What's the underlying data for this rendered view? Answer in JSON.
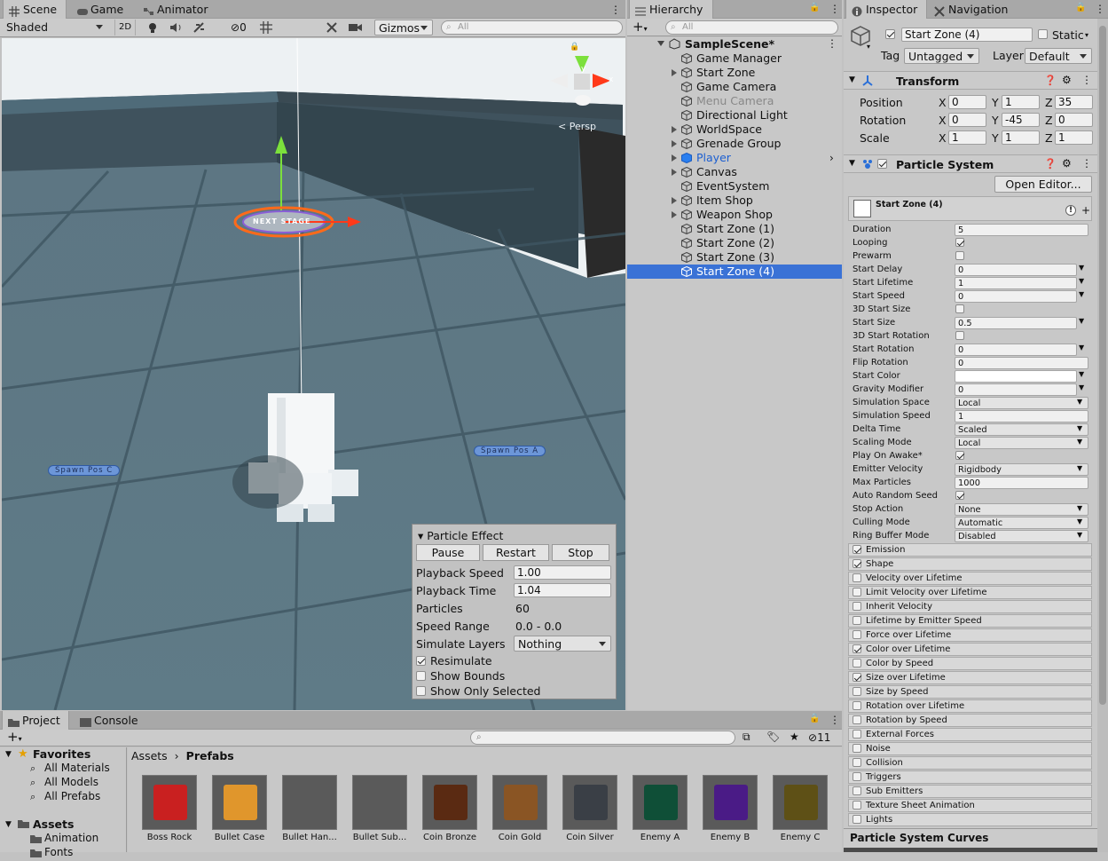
{
  "scene_tabs": [
    "Scene",
    "Game",
    "Animator"
  ],
  "scene_toolbar": {
    "shading": "Shaded",
    "mode_2d": "2D",
    "hidden_count": "0",
    "gizmos": "Gizmos",
    "search_placeholder": "All"
  },
  "scene_view": {
    "persp_label": "< Persp",
    "axis_x": "x",
    "axis_y": "y",
    "marker_a": "Spawn Pos A",
    "marker_c": "Spawn Pos C",
    "stage_text": "NEXT STAGE"
  },
  "particle_effect": {
    "title": "Particle Effect",
    "pause": "Pause",
    "restart": "Restart",
    "stop": "Stop",
    "playback_speed_label": "Playback Speed",
    "playback_speed": "1.00",
    "playback_time_label": "Playback Time",
    "playback_time": "1.04",
    "particles_label": "Particles",
    "particles": "60",
    "speed_range_label": "Speed Range",
    "speed_range": "0.0 - 0.0",
    "simulate_layers_label": "Simulate Layers",
    "simulate_layers": "Nothing",
    "resimulate": "Resimulate",
    "show_bounds": "Show Bounds",
    "show_only_selected": "Show Only Selected"
  },
  "hierarchy": {
    "tab": "Hierarchy",
    "search_placeholder": "All",
    "scene": "SampleScene*",
    "items": [
      {
        "label": "Game Manager",
        "arrow": false
      },
      {
        "label": "Start Zone",
        "arrow": true
      },
      {
        "label": "Game Camera",
        "arrow": false
      },
      {
        "label": "Menu Camera",
        "arrow": false
      },
      {
        "label": "Directional Light",
        "arrow": false
      },
      {
        "label": "WorldSpace",
        "arrow": true
      },
      {
        "label": "Grenade Group",
        "arrow": true
      },
      {
        "label": "Player",
        "arrow": true
      },
      {
        "label": "Canvas",
        "arrow": true
      },
      {
        "label": "EventSystem",
        "arrow": false
      },
      {
        "label": "Item Shop",
        "arrow": true
      },
      {
        "label": "Weapon Shop",
        "arrow": true
      },
      {
        "label": "Start Zone (1)",
        "arrow": false
      },
      {
        "label": "Start Zone (2)",
        "arrow": false
      },
      {
        "label": "Start Zone (3)",
        "arrow": false
      },
      {
        "label": "Start Zone (4)",
        "arrow": false
      }
    ]
  },
  "inspector": {
    "tabs": [
      "Inspector",
      "Navigation"
    ],
    "object_name": "Start Zone (4)",
    "static_label": "Static",
    "tag_label": "Tag",
    "tag": "Untagged",
    "layer_label": "Layer",
    "layer": "Default",
    "transform_title": "Transform",
    "position_label": "Position",
    "position": [
      "0",
      "1",
      "35"
    ],
    "rotation_label": "Rotation",
    "rotation": [
      "0",
      "-45",
      "0"
    ],
    "scale_label": "Scale",
    "scale": [
      "1",
      "1",
      "1"
    ],
    "axes": [
      "X",
      "Y",
      "Z"
    ],
    "ps_title": "Particle System",
    "open_editor": "Open Editor...",
    "ps_name": "Start Zone (4)",
    "props": [
      {
        "label": "Duration",
        "value": "5",
        "kind": "field"
      },
      {
        "label": "Looping",
        "value": "",
        "kind": "check_on"
      },
      {
        "label": "Prewarm",
        "value": "",
        "kind": "check_off"
      },
      {
        "label": "Start Delay",
        "value": "0",
        "kind": "fielddd"
      },
      {
        "label": "Start Lifetime",
        "value": "1",
        "kind": "fielddd"
      },
      {
        "label": "Start Speed",
        "value": "0",
        "kind": "fielddd"
      },
      {
        "label": "3D Start Size",
        "value": "",
        "kind": "check_off"
      },
      {
        "label": "Start Size",
        "value": "0.5",
        "kind": "fielddd"
      },
      {
        "label": "3D Start Rotation",
        "value": "",
        "kind": "check_off"
      },
      {
        "label": "Start Rotation",
        "value": "0",
        "kind": "fielddd"
      },
      {
        "label": "Flip Rotation",
        "value": "0",
        "kind": "field"
      },
      {
        "label": "Start Color",
        "value": "",
        "kind": "color"
      },
      {
        "label": "Gravity Modifier",
        "value": "0",
        "kind": "fielddd"
      },
      {
        "label": "Simulation Space",
        "value": "Local",
        "kind": "select"
      },
      {
        "label": "Simulation Speed",
        "value": "1",
        "kind": "field"
      },
      {
        "label": "Delta Time",
        "value": "Scaled",
        "kind": "select"
      },
      {
        "label": "Scaling Mode",
        "value": "Local",
        "kind": "select"
      },
      {
        "label": "Play On Awake*",
        "value": "",
        "kind": "check_on"
      },
      {
        "label": "Emitter Velocity",
        "value": "Rigidbody",
        "kind": "select"
      },
      {
        "label": "Max Particles",
        "value": "1000",
        "kind": "field"
      },
      {
        "label": "Auto Random Seed",
        "value": "",
        "kind": "check_on"
      },
      {
        "label": "Stop Action",
        "value": "None",
        "kind": "select"
      },
      {
        "label": "Culling Mode",
        "value": "Automatic",
        "kind": "select"
      },
      {
        "label": "Ring Buffer Mode",
        "value": "Disabled",
        "kind": "select"
      }
    ],
    "modules": [
      {
        "label": "Emission",
        "on": true
      },
      {
        "label": "Shape",
        "on": true
      },
      {
        "label": "Velocity over Lifetime",
        "on": false
      },
      {
        "label": "Limit Velocity over Lifetime",
        "on": false
      },
      {
        "label": "Inherit Velocity",
        "on": false
      },
      {
        "label": "Lifetime by Emitter Speed",
        "on": false
      },
      {
        "label": "Force over Lifetime",
        "on": false
      },
      {
        "label": "Color over Lifetime",
        "on": true
      },
      {
        "label": "Color by Speed",
        "on": false
      },
      {
        "label": "Size over Lifetime",
        "on": true
      },
      {
        "label": "Size by Speed",
        "on": false
      },
      {
        "label": "Rotation over Lifetime",
        "on": false
      },
      {
        "label": "Rotation by Speed",
        "on": false
      },
      {
        "label": "External Forces",
        "on": false
      },
      {
        "label": "Noise",
        "on": false
      },
      {
        "label": "Collision",
        "on": false
      },
      {
        "label": "Triggers",
        "on": false
      },
      {
        "label": "Sub Emitters",
        "on": false
      },
      {
        "label": "Texture Sheet Animation",
        "on": false
      },
      {
        "label": "Lights",
        "on": false
      }
    ],
    "curves_title": "Particle System Curves"
  },
  "project": {
    "tabs": [
      "Project",
      "Console"
    ],
    "hidden_count": "11",
    "favorites_label": "Favorites",
    "favorites": [
      "All Materials",
      "All Models",
      "All Prefabs"
    ],
    "assets_label": "Assets",
    "asset_folders": [
      "Animation",
      "Fonts"
    ],
    "breadcrumb": [
      "Assets",
      "Prefabs"
    ],
    "assets": [
      {
        "label": "Boss Rock",
        "color": "#c92020"
      },
      {
        "label": "Bullet Case",
        "color": "#e0962c"
      },
      {
        "label": "Bullet Han...",
        "color": ""
      },
      {
        "label": "Bullet Sub...",
        "color": ""
      },
      {
        "label": "Coin Bronze",
        "color": "#5a2a12"
      },
      {
        "label": "Coin Gold",
        "color": "#8a5524"
      },
      {
        "label": "Coin Silver",
        "color": "#3a3f46"
      },
      {
        "label": "Enemy A",
        "color": "#0f4f37"
      },
      {
        "label": "Enemy B",
        "color": "#4a1b86"
      },
      {
        "label": "Enemy C",
        "color": "#5e5016"
      }
    ]
  }
}
